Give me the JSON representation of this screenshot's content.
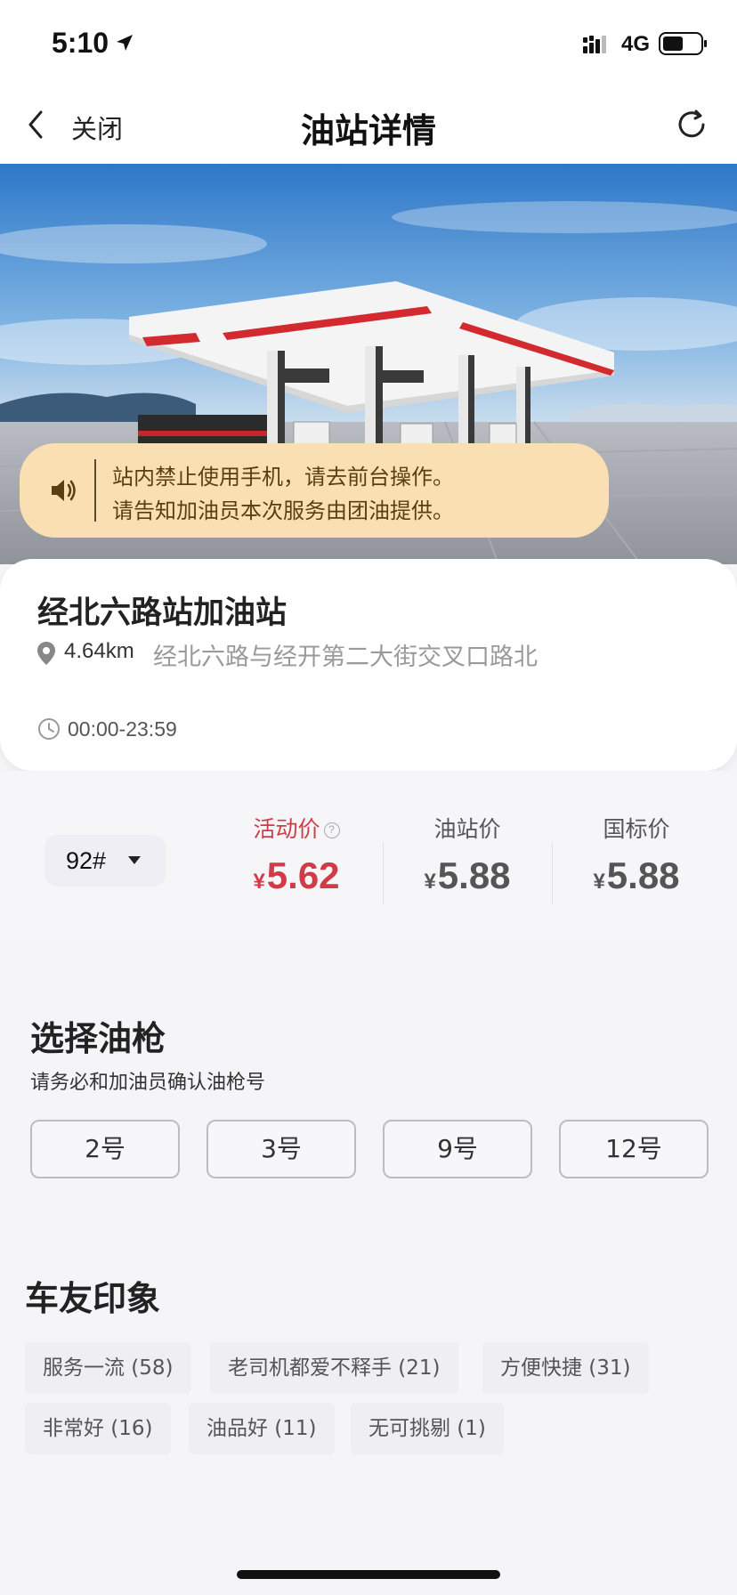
{
  "status_bar": {
    "time": "5:10",
    "network": "4G"
  },
  "nav": {
    "back_label": "关闭",
    "title": "油站详情"
  },
  "notice": {
    "line1": "站内禁止使用手机，请去前台操作。",
    "line2": "请告知加油员本次服务由团油提供。"
  },
  "station": {
    "name": "经北六路站加油站",
    "distance": "4.64km",
    "address": "经北六路与经开第二大街交叉口路北",
    "hours": "00:00-23:59"
  },
  "price": {
    "fuel_type": "92#",
    "currency": "¥",
    "activity_label": "活动价",
    "activity_value": "5.62",
    "station_label": "油站价",
    "station_value": "5.88",
    "national_label": "国标价",
    "national_value": "5.88"
  },
  "pump": {
    "title": "选择油枪",
    "subtitle": "请务必和加油员确认油枪号",
    "options": [
      "2号",
      "3号",
      "9号",
      "12号"
    ]
  },
  "impressions": {
    "title": "车友印象",
    "tags": [
      "服务一流 (58)",
      "老司机都爱不释手 (21)",
      "方便快捷 (31)",
      "非常好 (16)",
      "油品好 (11)",
      "无可挑剔 (1)"
    ]
  },
  "colors": {
    "accent": "#d13b48",
    "notice_bg": "#f9dfb1"
  }
}
